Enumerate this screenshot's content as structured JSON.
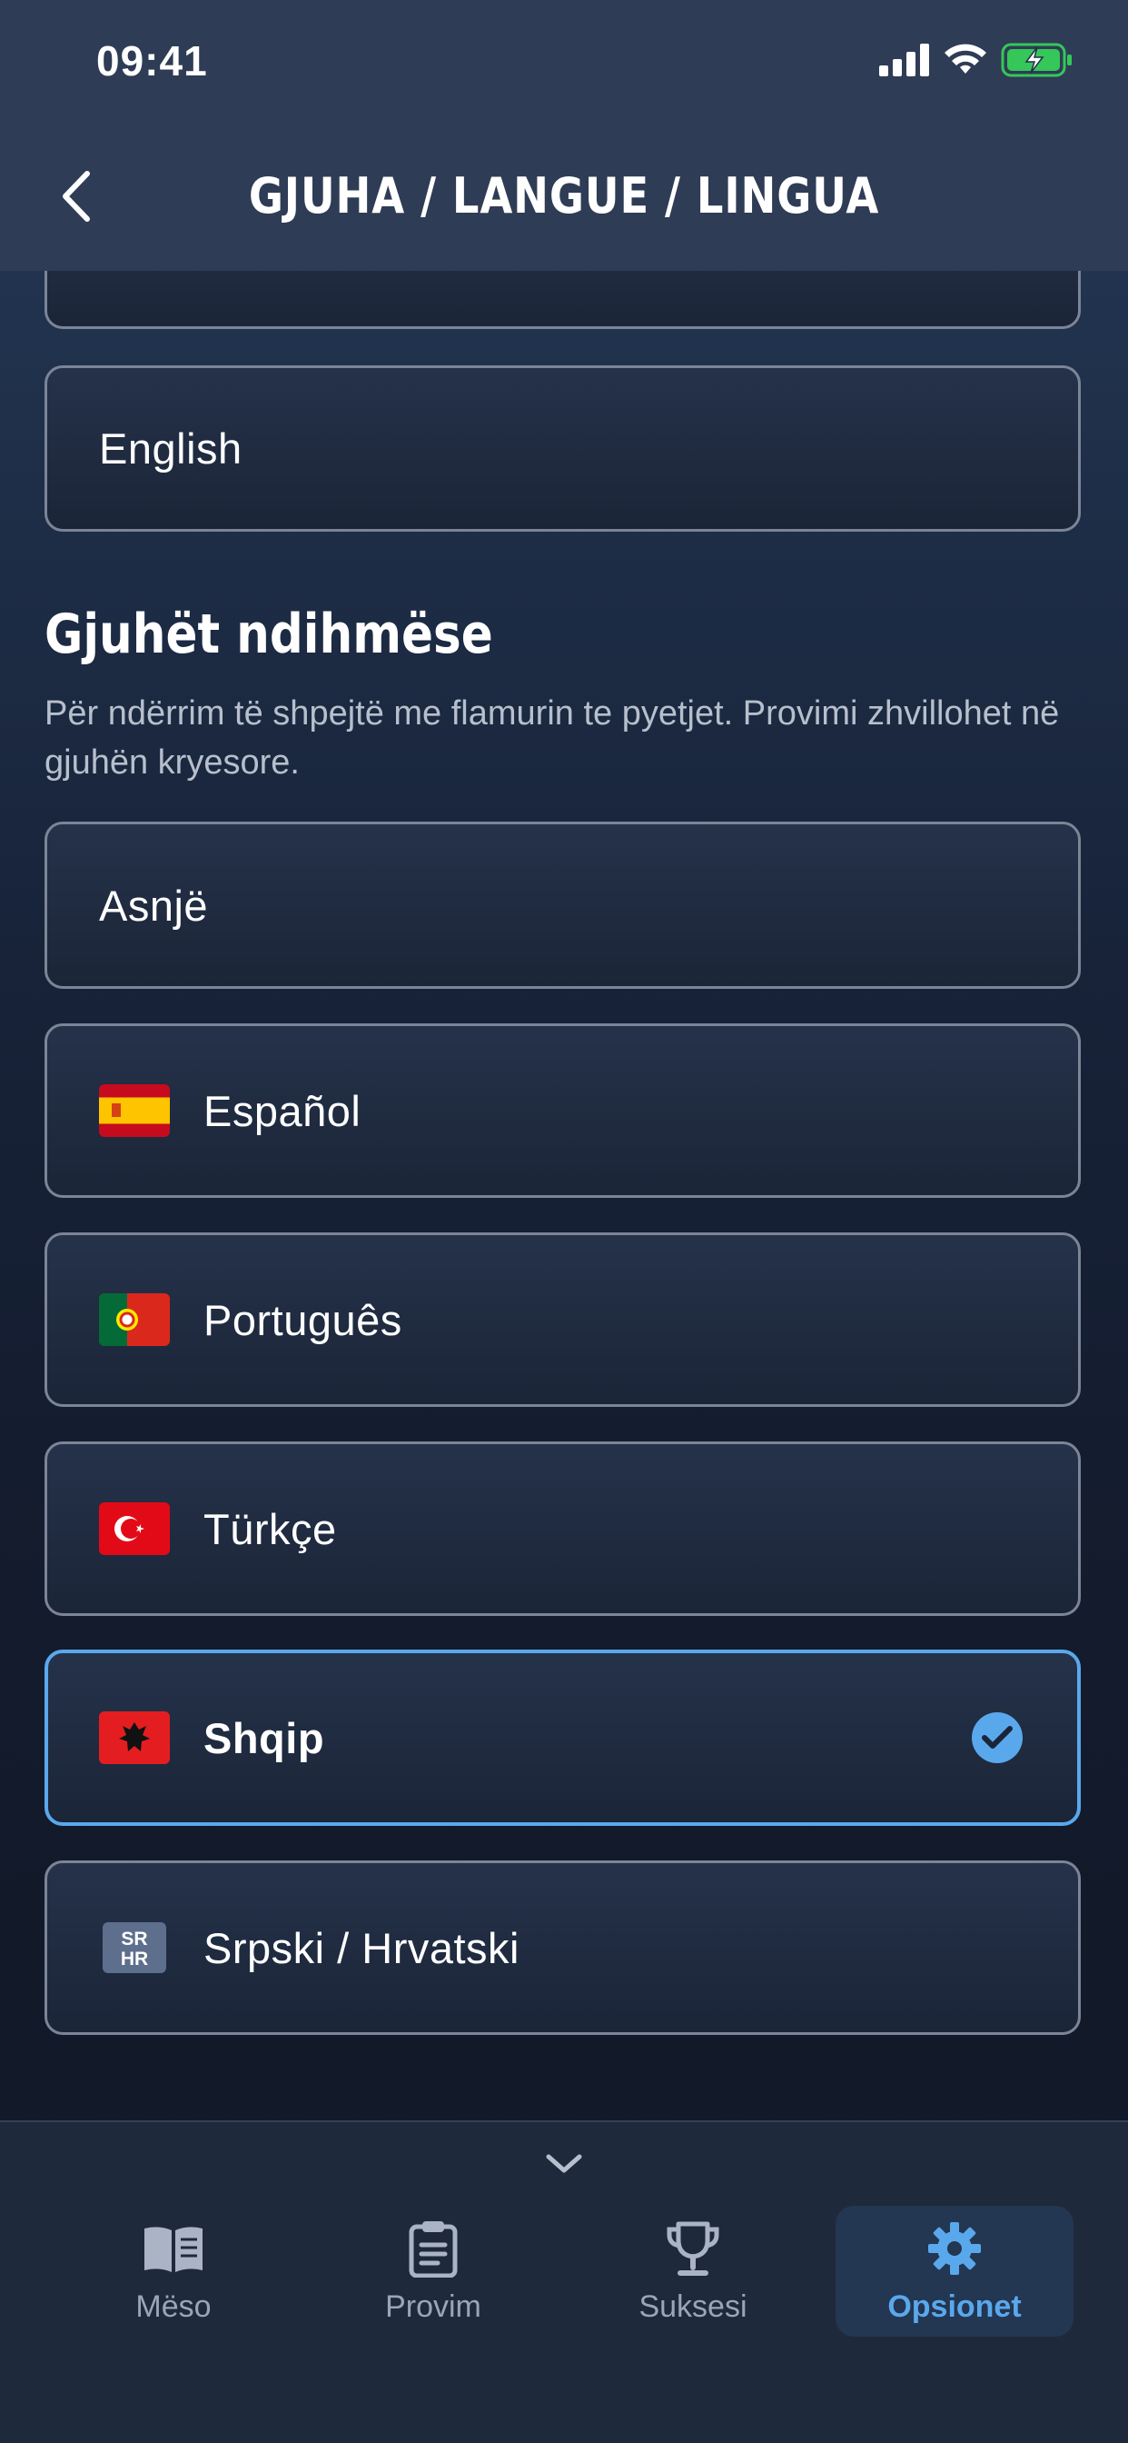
{
  "status_bar": {
    "time": "09:41"
  },
  "header": {
    "title": "GJUHA / LANGUE / LINGUA"
  },
  "primary_languages": [
    {
      "label": "English"
    }
  ],
  "auxiliary": {
    "title": "Gjuhët ndihmëse",
    "description": "Për ndërrim të shpejtë me flamurin te pyetjet. Provimi zhvillohet në gjuhën kryesore.",
    "options": [
      {
        "label": "Asnjë",
        "flag": "none",
        "selected": false
      },
      {
        "label": "Español",
        "flag": "spain-flag",
        "selected": false
      },
      {
        "label": "Português",
        "flag": "portugal-flag",
        "selected": false
      },
      {
        "label": "Türkçe",
        "flag": "turkey-flag",
        "selected": false
      },
      {
        "label": "Shqip",
        "flag": "albania-flag",
        "selected": true
      },
      {
        "label": "Srpski / Hrvatski",
        "flag": "sr-hr-badge",
        "badge_text": "SR\nHR",
        "selected": false
      }
    ]
  },
  "tabs": [
    {
      "label": "Mëso",
      "icon": "book-icon",
      "active": false
    },
    {
      "label": "Provim",
      "icon": "clipboard-icon",
      "active": false
    },
    {
      "label": "Suksesi",
      "icon": "trophy-icon",
      "active": false
    },
    {
      "label": "Opsionet",
      "icon": "gear-icon",
      "active": true
    }
  ],
  "colors": {
    "accent": "#5aa8ec",
    "header_bg": "#2f3c55",
    "card_border": "#7b8597"
  }
}
